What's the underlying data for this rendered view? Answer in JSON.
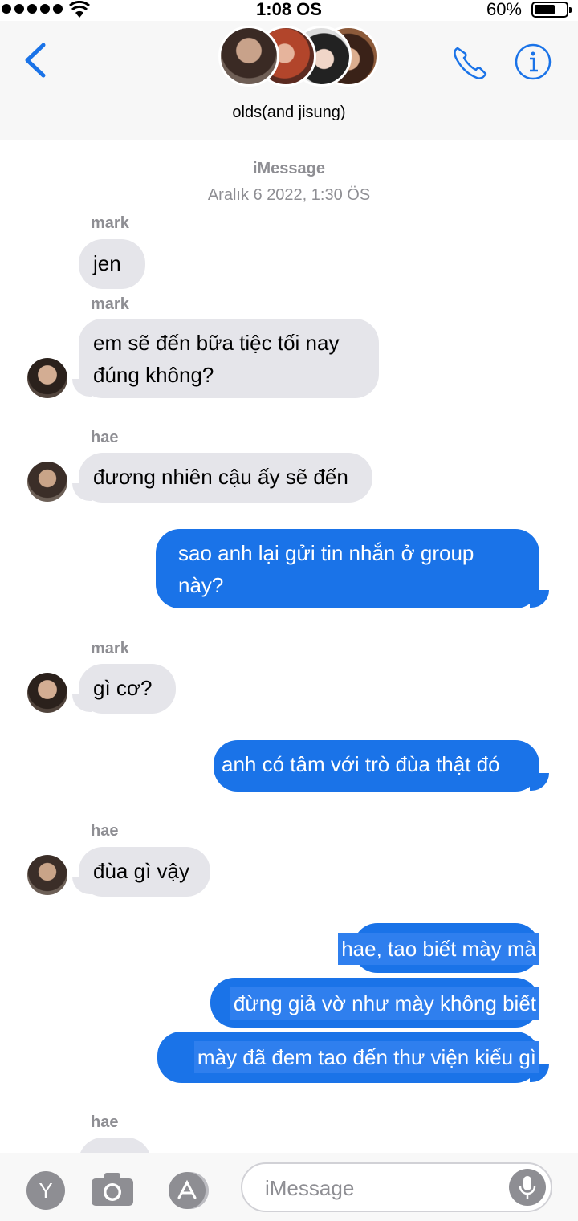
{
  "status_bar": {
    "time": "1:08 OS",
    "battery": "60%",
    "battery_level": 0.6
  },
  "header": {
    "group_name": "olds(and jisung)"
  },
  "conversation": {
    "service": "iMessage",
    "timestamp": "Aralık 6 2022, 1:30 ÖS",
    "items": [
      {
        "sender": "mark",
        "direction": "incoming",
        "text": "jen"
      },
      {
        "sender": "mark",
        "direction": "incoming",
        "text": "em sẽ đến bữa tiệc tối nay\nđúng không?"
      },
      {
        "sender": "hae",
        "direction": "incoming",
        "text": "đương nhiên cậu ấy sẽ đến"
      },
      {
        "direction": "outgoing",
        "text": "sao anh lại gửi tin nhắn ở group\nnày?"
      },
      {
        "sender": "mark",
        "direction": "incoming",
        "text": "gì cơ?"
      },
      {
        "direction": "outgoing",
        "text": "anh có tâm với trò đùa thật đó"
      },
      {
        "sender": "hae",
        "direction": "incoming",
        "text": "đùa gì vậy"
      },
      {
        "direction": "outgoing",
        "text": "hae, tao biết mày mà"
      },
      {
        "direction": "outgoing",
        "text": "đừng giả vờ như mày không biết"
      },
      {
        "direction": "outgoing",
        "text": "mày đã đem tao đến thư viện kiểu gì"
      },
      {
        "sender": "hae",
        "direction": "incoming",
        "text": ""
      }
    ]
  },
  "input_bar": {
    "placeholder": "iMessage",
    "app_button_letter": "Y"
  },
  "colors": {
    "outgoing_bubble": "#1a73e8",
    "incoming_bubble": "#e5e5ea",
    "accent": "#1a73e8"
  }
}
